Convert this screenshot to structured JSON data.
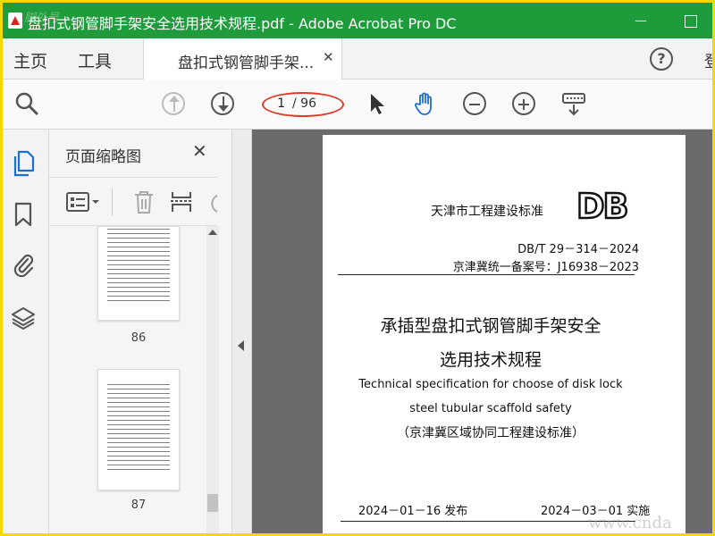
{
  "window": {
    "title": "盘扣式钢管脚手架安全选用技术规程.pdf - Adobe Acrobat Pro DC",
    "watermark_top": "脚外号"
  },
  "tabs": {
    "home": "主页",
    "tools": "工具",
    "document": "盘扣式钢管脚手架...",
    "help": "?",
    "signin": "登"
  },
  "toolbar": {
    "current_page": "1",
    "total_pages": "/ 96",
    "icons": [
      "search-zoom-icon",
      "page-up-icon",
      "page-down-icon",
      "select-arrow-icon",
      "hand-tool-icon",
      "zoom-out-icon",
      "zoom-in-icon",
      "keyboard-icon"
    ]
  },
  "panel": {
    "title": "页面缩略图",
    "thumbnails": [
      {
        "label": "86"
      },
      {
        "label": "87"
      }
    ]
  },
  "document": {
    "issuer": "天津市工程建设标准",
    "logo": "DB",
    "code": "DB/T 29－314－2024",
    "record": "京津冀统一备案号：J16938－2023",
    "title_line1": "承插型盘扣式钢管脚手架安全",
    "title_line2": "选用技术规程",
    "english_line1": "Technical specification for choose of disk lock",
    "english_line2": "steel tubular scaffold safety",
    "cn_note": "（京津冀区域协同工程建设标准）",
    "issue_date": "2024－01－16 发布",
    "implement_date": "2024－03－01 实施"
  },
  "watermark_bottom": "www.cnda",
  "colors": {
    "titlebar": "#1e9b3a",
    "border": "#f5d800",
    "ellipse": "#e23a2a",
    "accent_blue": "#1b6fd0"
  }
}
